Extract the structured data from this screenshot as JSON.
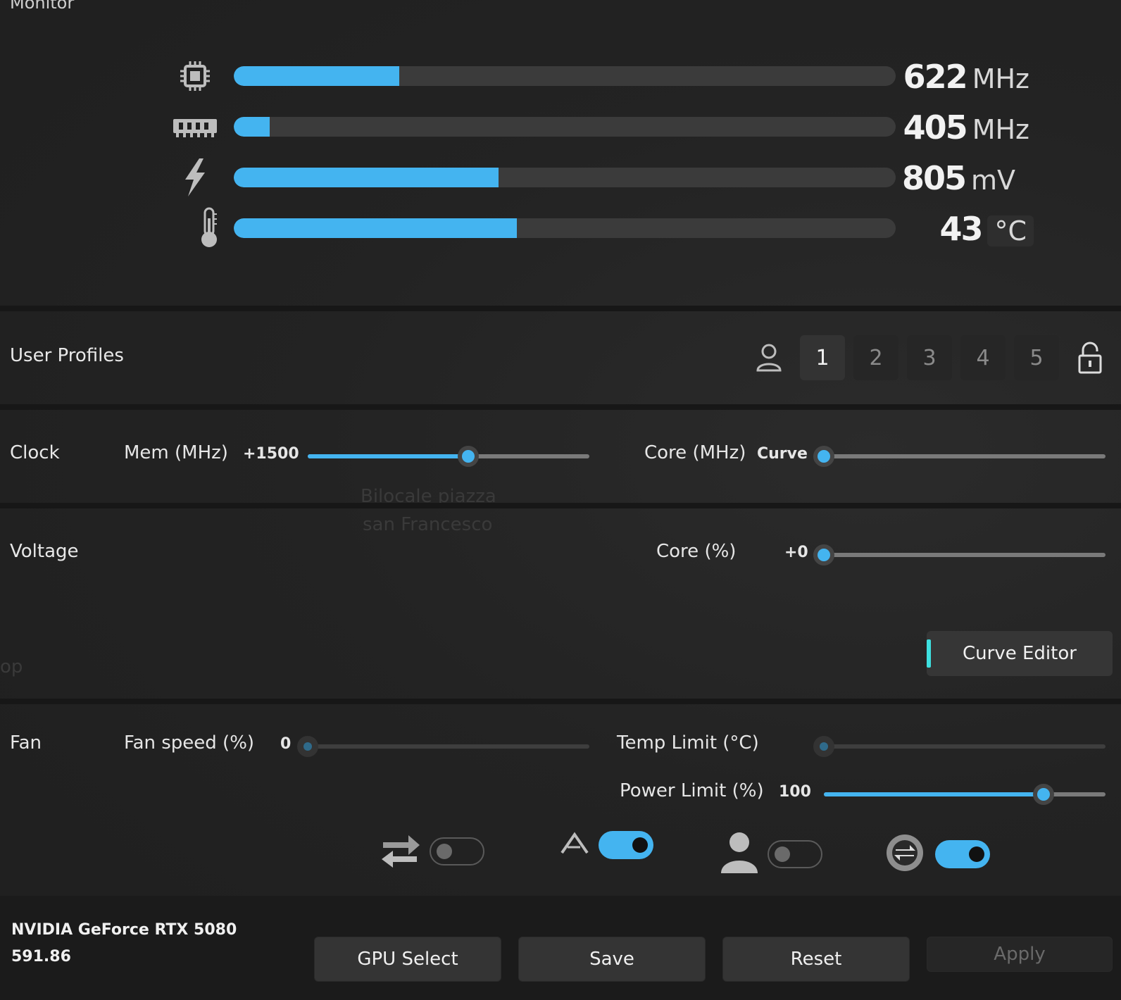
{
  "monitor": {
    "title": "Monitor",
    "rows": [
      {
        "icon": "gpu-chip-icon",
        "value": "622",
        "unit": "MHz",
        "level": 0.25
      },
      {
        "icon": "memory-icon",
        "value": "405",
        "unit": "MHz",
        "level": 0.054
      },
      {
        "icon": "voltage-icon",
        "value": "805",
        "unit": "mV",
        "level": 0.4
      },
      {
        "icon": "thermometer-icon",
        "value": "43",
        "unit": "°C",
        "level": 0.428
      }
    ]
  },
  "profiles": {
    "title": "User Profiles",
    "items": [
      "1",
      "2",
      "3",
      "4",
      "5"
    ],
    "active": "1"
  },
  "clock": {
    "title": "Clock",
    "mem_label": "Mem (MHz)",
    "mem_value": "+1500",
    "mem_level": 0.57,
    "core_label": "Core (MHz)",
    "core_value": "Curve",
    "core_level": 0.0
  },
  "voltage": {
    "title": "Voltage",
    "core_label": "Core (%)",
    "core_value": "+0",
    "core_level": 0.0,
    "curve_editor_label": "Curve Editor"
  },
  "fan": {
    "title": "Fan",
    "fan_speed_label": "Fan speed (%)",
    "fan_speed_value": "0",
    "fan_level": 0.0,
    "temp_limit_label": "Temp Limit (°C)",
    "temp_level": 0.0,
    "power_limit_label": "Power Limit (%)",
    "power_limit_value": "100",
    "power_level": 0.78,
    "toggles": [
      {
        "icon": "sync-arrows-icon",
        "on": false
      },
      {
        "icon": "auto-icon",
        "on": true
      },
      {
        "icon": "user-icon",
        "on": false
      },
      {
        "icon": "fan-sync-icon",
        "on": true
      }
    ]
  },
  "footer": {
    "gpu_name": "NVIDIA GeForce RTX 5080",
    "driver": "591.86",
    "gpu_select_label": "GPU Select",
    "save_label": "Save",
    "reset_label": "Reset",
    "apply_label": "Apply"
  },
  "background": {
    "ghost_text_1": "Bilocale piazza",
    "ghost_text_2": "san Francesco",
    "ghost_text_3": "op"
  },
  "colors": {
    "accent": "#44b4f0",
    "curve_accent": "#3ee0e0",
    "background": "#202020"
  }
}
